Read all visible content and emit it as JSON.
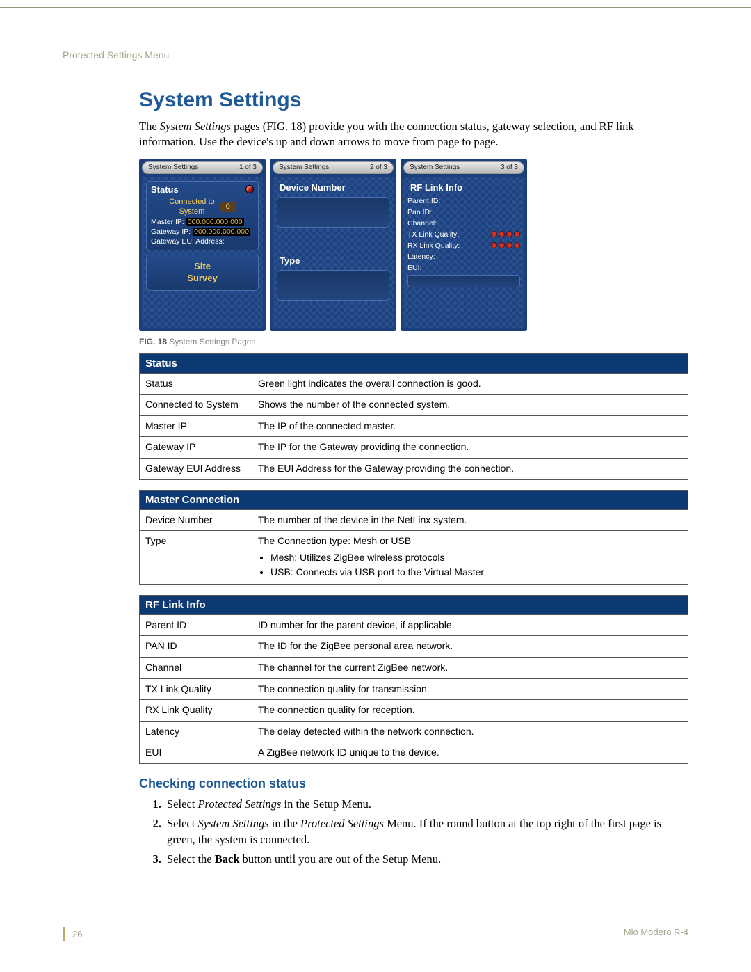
{
  "header": {
    "breadcrumb": "Protected Settings Menu"
  },
  "title": "System Settings",
  "intro_html": "The <em>System Settings</em> pages (FIG. 18) provide you with the connection status, gateway selection, and RF link information. Use the device's up and down arrows to move from page to page.",
  "figure": {
    "caption_bold": "FIG. 18",
    "caption_rest": "  System Settings Pages",
    "screens": [
      {
        "tab_title": "System Settings",
        "tab_page": "1 of 3",
        "status": {
          "title": "Status",
          "connected_label": "Connected to\nSystem",
          "connected_value": "0",
          "master_ip_label": "Master IP:",
          "master_ip_value": "000.000.000.000",
          "gateway_ip_label": "Gateway IP:",
          "gateway_ip_value": "000.000.000.000",
          "gateway_eui_label": "Gateway EUI Address:"
        },
        "site_survey": "Site\nSurvey"
      },
      {
        "tab_title": "System Settings",
        "tab_page": "2 of 3",
        "device_number_title": "Device Number",
        "type_title": "Type"
      },
      {
        "tab_title": "System Settings",
        "tab_page": "3 of 3",
        "rf_title": "RF Link Info",
        "rows": {
          "parent_id": "Parent ID:",
          "pan_id": "Pan ID:",
          "channel": "Channel:",
          "tx": "TX Link Quality:",
          "rx": "RX Link Quality:",
          "latency": "Latency:",
          "eui": "EUI:"
        }
      }
    ]
  },
  "tables": {
    "status": {
      "title": "Status",
      "rows": [
        {
          "k": "Status",
          "v": "Green light indicates the overall connection is good."
        },
        {
          "k": "Connected to System",
          "v": "Shows the number of the connected system."
        },
        {
          "k": "Master IP",
          "v": "The IP of the connected master."
        },
        {
          "k": "Gateway IP",
          "v": "The IP for the Gateway providing the connection."
        },
        {
          "k": "Gateway EUI Address",
          "v": "The EUI Address for the Gateway providing the connection."
        }
      ]
    },
    "master": {
      "title": "Master Connection",
      "rows": [
        {
          "k": "Device Number",
          "v": "The number of the device in the NetLinx system."
        },
        {
          "k": "Type",
          "v": "The Connection type: Mesh or USB",
          "bullets": [
            "Mesh: Utilizes ZigBee wireless protocols",
            "USB: Connects via USB port to the Virtual Master"
          ]
        }
      ]
    },
    "rflink": {
      "title": "RF Link Info",
      "rows": [
        {
          "k": "Parent ID",
          "v": "ID number for the parent device, if applicable."
        },
        {
          "k": "PAN ID",
          "v": "The ID for the ZigBee personal area network."
        },
        {
          "k": "Channel",
          "v": "The channel for the current ZigBee network."
        },
        {
          "k": "TX Link Quality",
          "v": "The connection quality for transmission."
        },
        {
          "k": "RX Link Quality",
          "v": "The connection quality for reception."
        },
        {
          "k": "Latency",
          "v": "The delay detected within the network connection."
        },
        {
          "k": "EUI",
          "v": "A ZigBee network ID unique to the device."
        }
      ]
    }
  },
  "checking": {
    "title": "Checking connection status",
    "steps": [
      "Select <em>Protected Settings</em> in the Setup Menu.",
      "Select <em>System Settings</em> in the <em>Protected Settings</em> Menu. If the round button at the top right of the first page is green, the system is connected.",
      "Select the <b>Back</b> button until you are out of the Setup Menu."
    ]
  },
  "footer": {
    "page_number": "26",
    "doc_title": "Mio Modero R-4"
  }
}
